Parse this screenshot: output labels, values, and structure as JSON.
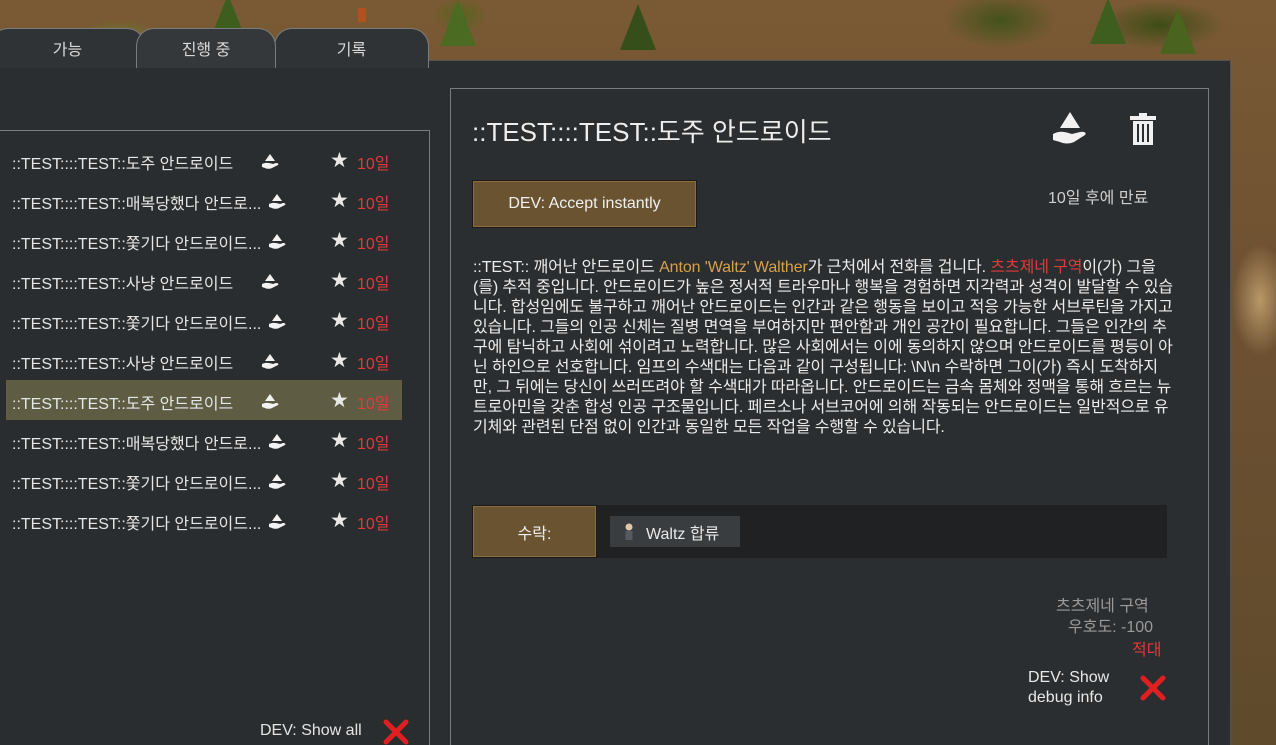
{
  "tabs": [
    {
      "label": "가능"
    },
    {
      "label": "진행 중"
    },
    {
      "label": "기록"
    }
  ],
  "quest_list": [
    {
      "name": "::TEST::::TEST::도주 안드로이드",
      "days": "10일",
      "selected": false
    },
    {
      "name": "::TEST::::TEST::매복당했다 안드로...",
      "days": "10일",
      "selected": false
    },
    {
      "name": "::TEST::::TEST::쫓기다 안드로이드...",
      "days": "10일",
      "selected": false
    },
    {
      "name": "::TEST::::TEST::사냥 안드로이드",
      "days": "10일",
      "selected": false
    },
    {
      "name": "::TEST::::TEST::쫓기다 안드로이드...",
      "days": "10일",
      "selected": false
    },
    {
      "name": "::TEST::::TEST::사냥 안드로이드",
      "days": "10일",
      "selected": false
    },
    {
      "name": "::TEST::::TEST::도주 안드로이드",
      "days": "10일",
      "selected": true
    },
    {
      "name": "::TEST::::TEST::매복당했다 안드로...",
      "days": "10일",
      "selected": false
    },
    {
      "name": "::TEST::::TEST::쫓기다 안드로이드...",
      "days": "10일",
      "selected": false
    },
    {
      "name": "::TEST::::TEST::쫓기다 안드로이드...",
      "days": "10일",
      "selected": false
    }
  ],
  "show_all_label": "DEV: Show all",
  "detail": {
    "title": "::TEST::::TEST::도주 안드로이드",
    "dev_accept_label": "DEV: Accept instantly",
    "expires": "10일 후에 만료",
    "desc_prefix": "::TEST:: 깨어난 안드로이드 ",
    "desc_pawn": "Anton 'Waltz' Walther",
    "desc_mid": "가 근처에서 전화를 겁니다. ",
    "desc_faction": "츠츠제네 구역",
    "desc_rest": "이(가) 그을(를) 추적 중입니다. 안드로이드가 높은 정서적 트라우마나 행복을 경험하면 지각력과 성격이 발달할 수 있습니다. 합성임에도 불구하고 깨어난 안드로이드는 인간과 같은 행동을 보이고 적응 가능한 서브루틴을 가지고 있습니다. 그들의 인공 신체는 질병 면역을 부여하지만 편안함과 개인 공간이 필요합니다. 그들은 인간의 추구에 탐닉하고 사회에 섞이려고 노력합니다. 많은 사회에서는 이에 동의하지 않으며 안드로이드를 평등이 아닌 하인으로 선호합니다. 임프의 수색대는 다음과 같이 구성됩니다: \\N\\n 수락하면 그이(가) 즉시 도착하지만, 그 뒤에는 당신이 쓰러뜨려야 할 수색대가 따라옵니다. 안드로이드는 금속 몸체와 정맥을 통해 흐르는 뉴트로아민을 갖춘 합성 인공 구조물입니다. 페르소나 서브코어에 의해 작동되는 안드로이드는 일반적으로 유기체와 관련된 단점 없이 인간과 동일한 모든 작업을 수행할 수 있습니다.",
    "accept_label": "수락:",
    "reward_label": "Waltz 합류",
    "faction_name": "츠츠제네 구역",
    "goodwill": "우호도: -100",
    "relation": "적대",
    "debug_label": "DEV: Show debug info"
  },
  "colors": {
    "hostile": "#e03a3a",
    "pawn": "#d8a04a",
    "button": "#6a5331",
    "selected_row": "#5e5d44",
    "panel": "#2b2e30"
  },
  "icons": [
    "star-icon",
    "quest-drop-icon",
    "accept-quest-icon",
    "trash-icon",
    "close-x-icon",
    "pawn-icon"
  ]
}
